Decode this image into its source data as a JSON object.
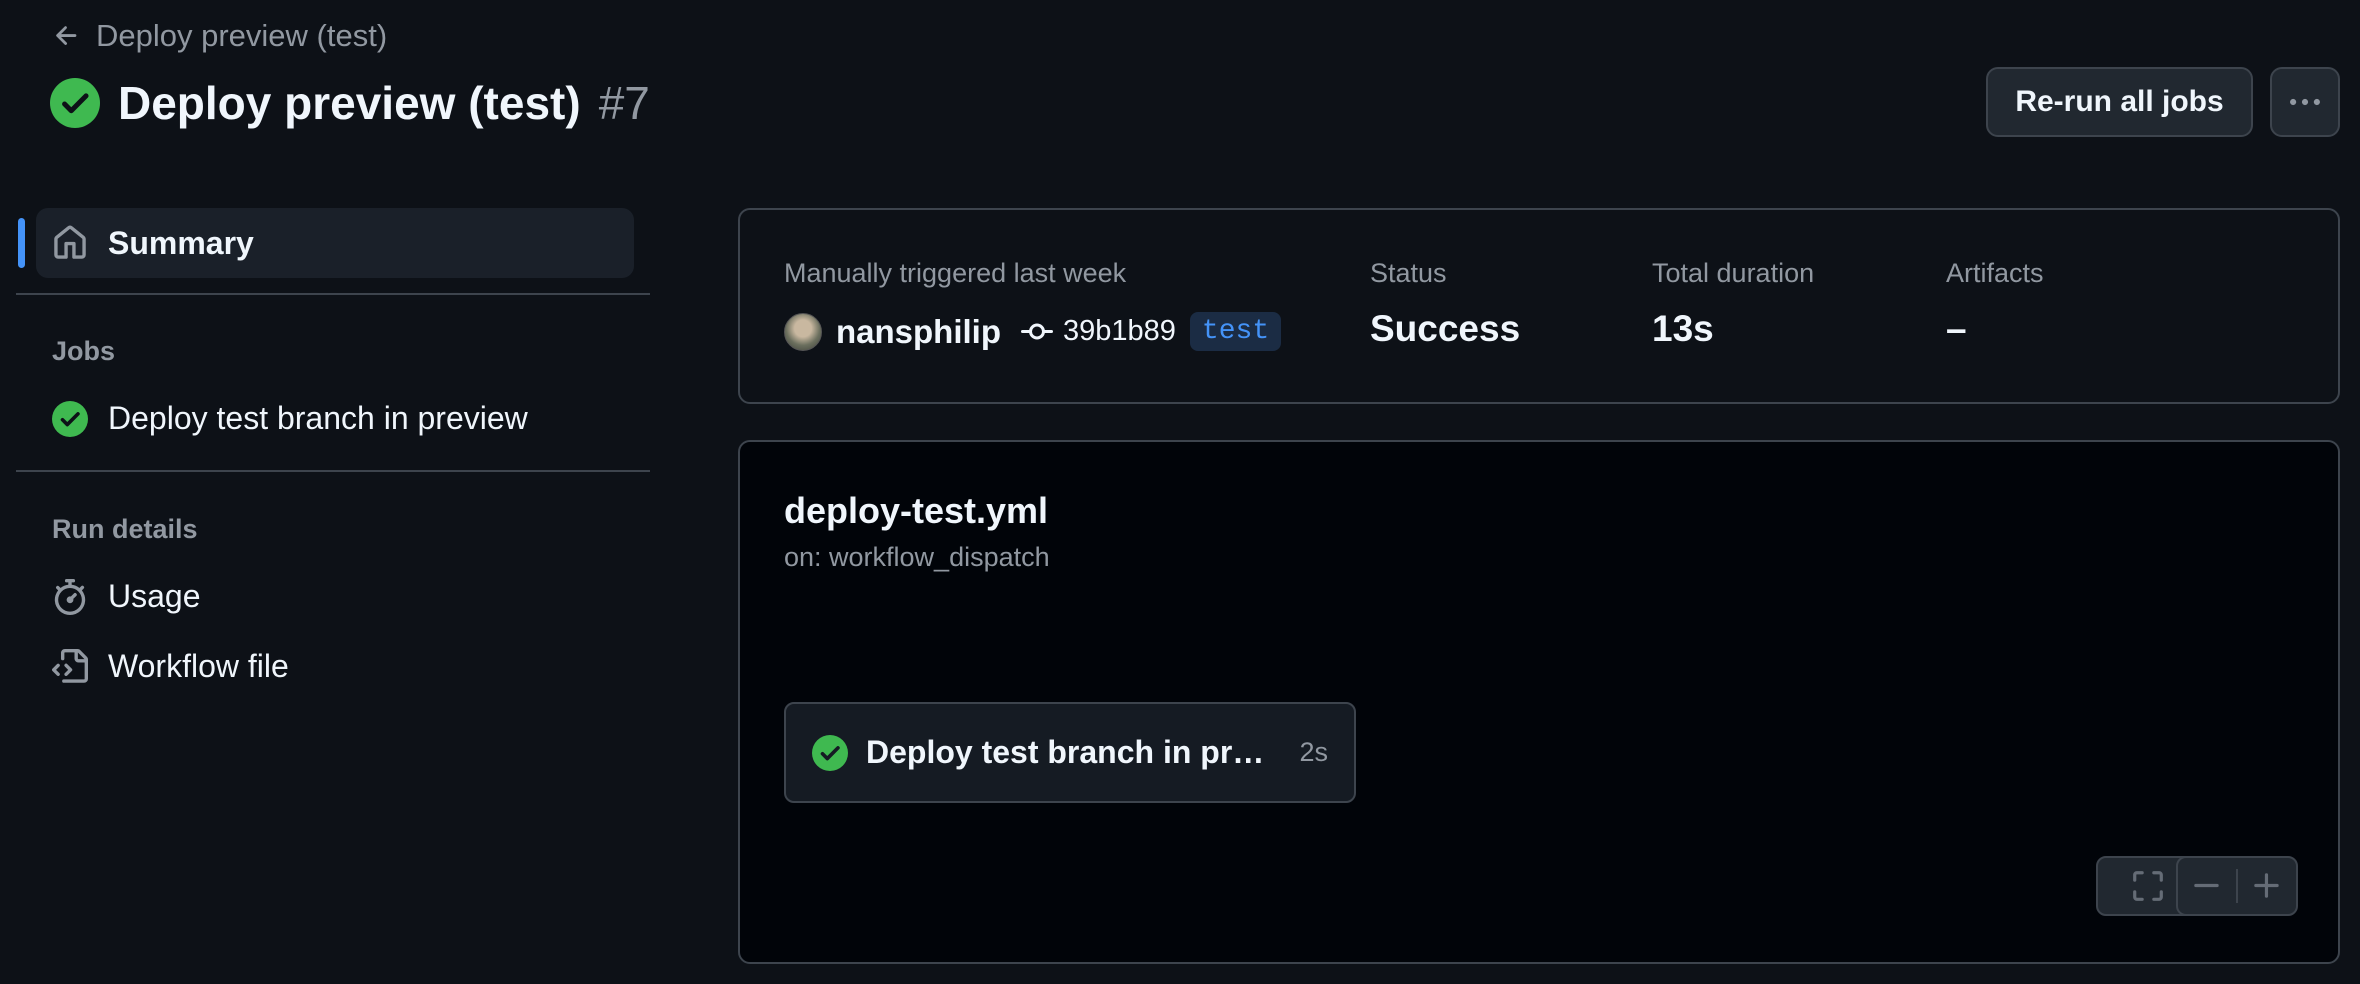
{
  "header": {
    "back_label": "Deploy preview (test)",
    "title": "Deploy preview (test)",
    "run_number": "#7",
    "rerun_label": "Re-run all jobs"
  },
  "sidebar": {
    "summary_label": "Summary",
    "jobs_heading": "Jobs",
    "jobs": [
      {
        "label": "Deploy test branch in preview",
        "status": "success"
      }
    ],
    "run_details_heading": "Run details",
    "usage_label": "Usage",
    "workflow_file_label": "Workflow file"
  },
  "summary": {
    "trigger_label": "Manually triggered last week",
    "user": "nansphilip",
    "commit": "39b1b89",
    "branch": "test",
    "status_label": "Status",
    "status_value": "Success",
    "duration_label": "Total duration",
    "duration_value": "13s",
    "artifacts_label": "Artifacts",
    "artifacts_value": "–"
  },
  "graph": {
    "workflow_name": "deploy-test.yml",
    "trigger": "on: workflow_dispatch",
    "job_name": "Deploy test branch in preview",
    "job_duration": "2s"
  },
  "colors": {
    "success": "#3fb950",
    "accent": "#4493f8",
    "background": "#0d1117"
  }
}
